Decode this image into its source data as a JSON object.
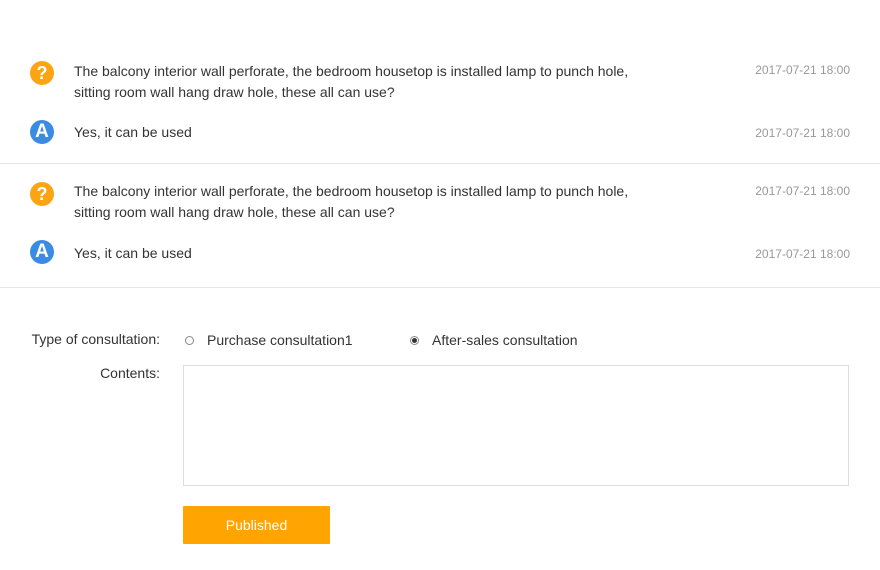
{
  "qa_items": [
    {
      "question": {
        "text_line1": "The balcony interior wall perforate, the bedroom housetop is installed lamp to punch hole,",
        "text_line2": "sitting room wall hang draw hole, these all can use?",
        "time": "2017-07-21 18:00",
        "badge": "?"
      },
      "answer": {
        "text": "Yes, it can be used",
        "time": "2017-07-21 18:00",
        "badge": "A"
      }
    },
    {
      "question": {
        "text_line1": "The balcony interior wall perforate, the bedroom housetop is installed lamp to punch hole,",
        "text_line2": "sitting room wall hang draw hole, these all can use?",
        "time": "2017-07-21 18:00",
        "badge": "?"
      },
      "answer": {
        "text": "Yes, it can be used",
        "time": "2017-07-21 18:00",
        "badge": "A"
      }
    }
  ],
  "form": {
    "type_label": "Type of consultation:",
    "options": [
      {
        "label": "Purchase consultation1",
        "checked": false
      },
      {
        "label": "After-sales consultation",
        "checked": true
      }
    ],
    "contents_label": "Contents:",
    "contents_value": "",
    "submit_label": "Published"
  },
  "colors": {
    "question_badge": "#fda413",
    "answer_badge": "#3b8be3",
    "button": "#ffa400"
  }
}
